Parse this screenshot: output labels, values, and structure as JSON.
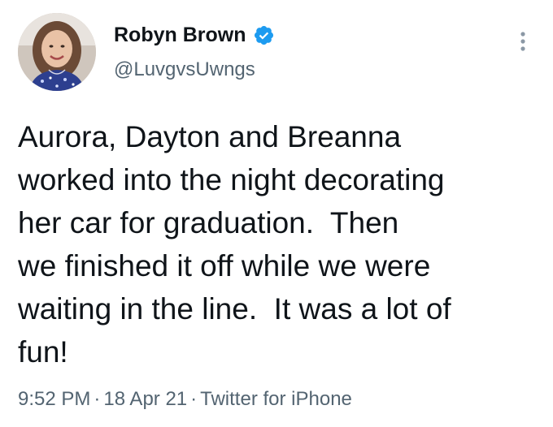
{
  "tweet": {
    "author": {
      "display_name": "Robyn Brown",
      "handle": "@LuvgvsUwngs",
      "verified": true,
      "avatar_icon": "user-photo"
    },
    "text": "Aurora, Dayton and Breanna\nworked into the night decorating\nher car for graduation.  Then\nwe finished it off while we were\nwaiting in the line.  It was a lot of\nfun!",
    "time": "9:52 PM",
    "date": "18 Apr 21",
    "source": "Twitter for iPhone",
    "separator": "·"
  },
  "colors": {
    "text": "#0f1419",
    "secondary": "#536471",
    "verified_badge": "#1d9bf0",
    "background": "#ffffff"
  }
}
